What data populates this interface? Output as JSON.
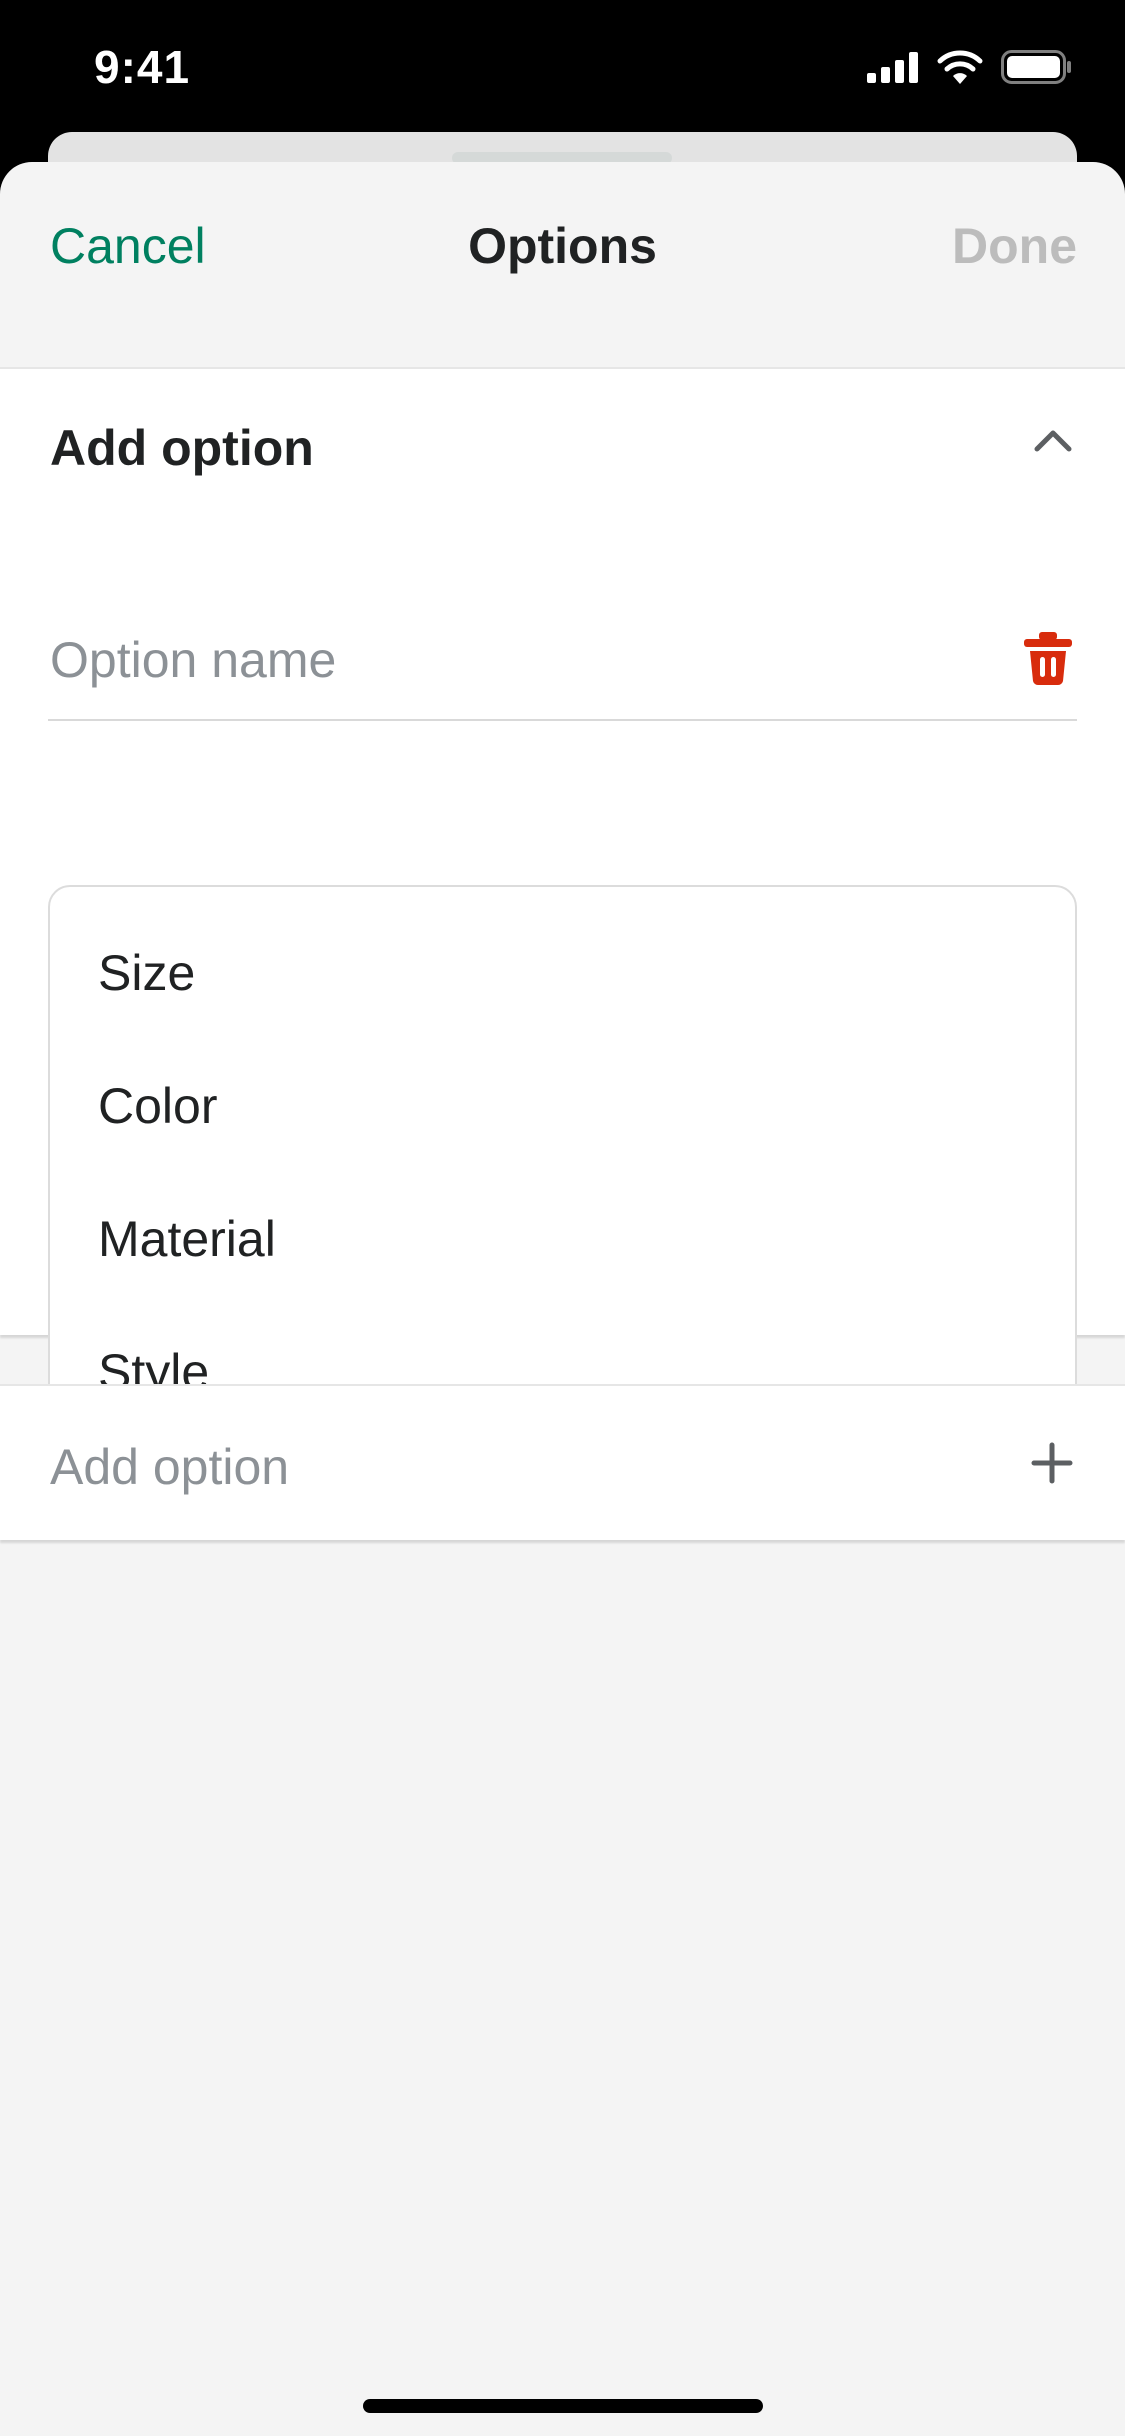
{
  "status_bar": {
    "time": "9:41"
  },
  "nav": {
    "cancel_label": "Cancel",
    "title": "Options",
    "done_label": "Done"
  },
  "option_card": {
    "title": "Add option",
    "name_field": {
      "value": "",
      "placeholder": "Option name"
    },
    "suggestions": [
      "Size",
      "Color",
      "Material",
      "Style"
    ]
  },
  "add_option_row": {
    "label": "Add option"
  },
  "colors": {
    "accent": "#008060",
    "destructive": "#d82c0d",
    "disabled": "#bcbcbc",
    "background": "#f4f4f4"
  },
  "icons": [
    "cellular-signal-icon",
    "wifi-icon",
    "battery-icon",
    "chevron-up-icon",
    "trash-icon",
    "plus-icon"
  ]
}
